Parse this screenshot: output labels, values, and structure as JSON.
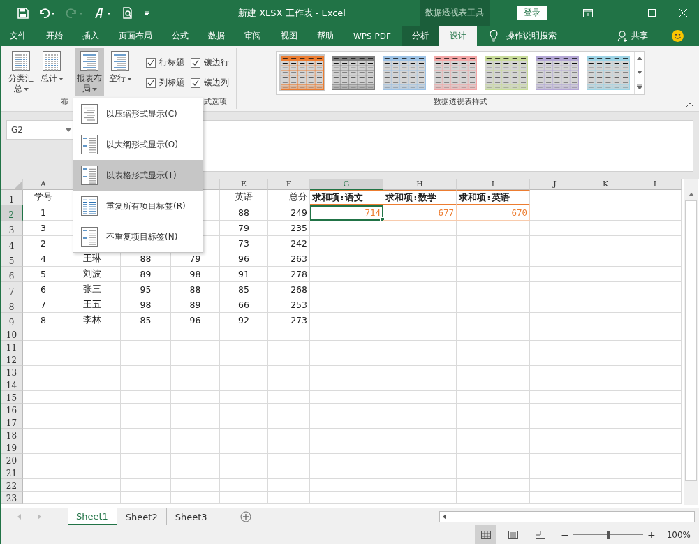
{
  "window": {
    "title": "新建 XLSX 工作表 - Excel",
    "sign_in": "登录",
    "context_group": "数据透视表工具",
    "quick_access": [
      {
        "kind": "save",
        "disabled": false
      },
      {
        "kind": "undo",
        "disabled": false
      },
      {
        "kind": "redo",
        "disabled": true
      },
      {
        "kind": "touch",
        "disabled": false
      },
      {
        "kind": "preview",
        "disabled": false
      },
      {
        "kind": "customize",
        "disabled": false
      }
    ]
  },
  "menu_tabs": [
    {
      "label": "文件",
      "selected": false,
      "context": false
    },
    {
      "label": "开始",
      "selected": false,
      "context": false
    },
    {
      "label": "插入",
      "selected": false,
      "context": false
    },
    {
      "label": "页面布局",
      "selected": false,
      "context": false
    },
    {
      "label": "公式",
      "selected": false,
      "context": false
    },
    {
      "label": "数据",
      "selected": false,
      "context": false
    },
    {
      "label": "审阅",
      "selected": false,
      "context": false
    },
    {
      "label": "视图",
      "selected": false,
      "context": false
    },
    {
      "label": "帮助",
      "selected": false,
      "context": false
    },
    {
      "label": "WPS PDF",
      "selected": false,
      "context": false
    },
    {
      "label": "分析",
      "selected": false,
      "context": true
    },
    {
      "label": "设计",
      "selected": true,
      "context": true
    }
  ],
  "tell_me": "操作说明搜索",
  "share": "共享",
  "ribbon": {
    "layout_group": {
      "label": "布",
      "buttons": [
        {
          "label": "分类汇总",
          "kind": "subtotal",
          "pressed": false
        },
        {
          "label": "总计",
          "kind": "total",
          "pressed": false
        },
        {
          "label": "报表布局",
          "kind": "report",
          "pressed": true
        },
        {
          "label": "空行",
          "kind": "blank",
          "pressed": false
        }
      ]
    },
    "options_group": {
      "label": "式选项",
      "checkboxes": [
        {
          "label": "行标题",
          "checked": true
        },
        {
          "label": "镶边行",
          "checked": true
        },
        {
          "label": "列标题",
          "checked": true
        },
        {
          "label": "镶边列",
          "checked": true
        }
      ]
    },
    "styles_group": {
      "label": "数据透视表样式",
      "styles": [
        {
          "color": "#ed7d31",
          "selected": true
        },
        {
          "color": "#7f7f7f",
          "selected": false
        },
        {
          "color": "#9dc3e6",
          "selected": false
        },
        {
          "color": "#f4a6a6",
          "selected": false
        },
        {
          "color": "#c9dc9a",
          "selected": false
        },
        {
          "color": "#b4a7d6",
          "selected": false
        },
        {
          "color": "#9dd4e6",
          "selected": false
        }
      ]
    }
  },
  "dropdown": {
    "items": [
      {
        "label": "以压缩形式显示(C)",
        "kind": "compact",
        "selected": false
      },
      {
        "label": "以大纲形式显示(O)",
        "kind": "outline",
        "selected": false
      },
      {
        "label": "以表格形式显示(T)",
        "kind": "tabular",
        "selected": true
      },
      {
        "label": "重复所有项目标签(R)",
        "kind": "repeat",
        "selected": false
      },
      {
        "label": "不重复项目标签(N)",
        "kind": "norepeat",
        "selected": false
      }
    ]
  },
  "name_box": "G2",
  "grid": {
    "columns": [
      {
        "letter": "A",
        "selected": false
      },
      {
        "selected": false
      },
      {},
      {
        "selected": false
      },
      {
        "letter": "E",
        "selected": false
      },
      {
        "letter": "F",
        "selected": false
      },
      {
        "letter": "G",
        "selected": true
      },
      {
        "letter": "H",
        "selected": false
      },
      {
        "letter": "I",
        "selected": false
      },
      {
        "letter": "J",
        "selected": false
      },
      {
        "letter": "K",
        "selected": false
      },
      {
        "letter": "L",
        "selected": false
      }
    ],
    "rows": [
      {
        "number": "1",
        "kind": "pivot_head",
        "selected": false,
        "cells": [
          "学号",
          null,
          null,
          null,
          "英语",
          "总分",
          "求和项:语文",
          "求和项:数学",
          "求和项:英语"
        ]
      },
      {
        "number": "2",
        "kind": "pivot_values",
        "selected": true,
        "cells": [
          "1",
          null,
          null,
          null,
          "88",
          "249",
          "714",
          "677",
          "670"
        ]
      },
      {
        "number": "3",
        "kind": "data",
        "selected": false,
        "cells": [
          "3",
          null,
          null,
          null,
          "79",
          "235"
        ]
      },
      {
        "number": "4",
        "kind": "data",
        "selected": false,
        "cells": [
          "2",
          null,
          null,
          null,
          "73",
          "242"
        ]
      },
      {
        "number": "5",
        "kind": "data",
        "selected": false,
        "cells": [
          "4",
          "王琳",
          "88",
          "79",
          "96",
          "263"
        ]
      },
      {
        "number": "6",
        "kind": "data",
        "selected": false,
        "cells": [
          "5",
          "刘波",
          "89",
          "98",
          "91",
          "278"
        ]
      },
      {
        "number": "7",
        "kind": "data",
        "selected": false,
        "cells": [
          "6",
          "张三",
          "95",
          "88",
          "85",
          "268"
        ]
      },
      {
        "number": "8",
        "kind": "data",
        "selected": false,
        "cells": [
          "7",
          "王五",
          "98",
          "89",
          "66",
          "253"
        ]
      },
      {
        "number": "9",
        "kind": "data",
        "selected": false,
        "cells": [
          "8",
          "李林",
          "85",
          "96",
          "92",
          "273"
        ]
      },
      {
        "number": "10",
        "kind": "empty",
        "selected": false
      },
      {
        "number": "11",
        "kind": "empty",
        "selected": false
      },
      {
        "number": "12",
        "kind": "empty",
        "selected": false
      },
      {
        "number": "13",
        "kind": "empty",
        "selected": false
      },
      {
        "number": "14",
        "kind": "empty",
        "selected": false
      },
      {
        "number": "15",
        "kind": "empty",
        "selected": false
      },
      {
        "number": "16",
        "kind": "empty",
        "selected": false
      },
      {
        "number": "17",
        "kind": "empty",
        "selected": false
      },
      {
        "number": "18",
        "kind": "empty",
        "selected": false
      },
      {
        "number": "19",
        "kind": "empty",
        "selected": false
      },
      {
        "number": "20",
        "kind": "empty",
        "selected": false
      },
      {
        "number": "21",
        "kind": "empty",
        "selected": false
      },
      {
        "number": "22",
        "kind": "empty",
        "selected": false
      },
      {
        "number": "23",
        "kind": "empty",
        "selected": false
      }
    ]
  },
  "sheets": [
    {
      "label": "Sheet1",
      "selected": true
    },
    {
      "label": "Sheet2",
      "selected": false
    },
    {
      "label": "Sheet3",
      "selected": false
    }
  ],
  "status_bar": {
    "views": [
      {
        "kind": "normal",
        "selected": true
      },
      {
        "kind": "page_layout",
        "selected": false
      },
      {
        "kind": "page_break",
        "selected": false
      }
    ],
    "zoom": {
      "minus": "−",
      "plus": "+",
      "level": 0.5,
      "reading": "100%"
    }
  }
}
